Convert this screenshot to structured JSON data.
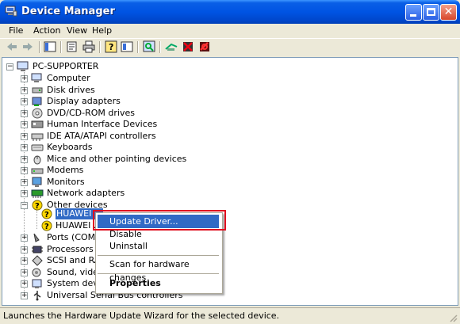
{
  "window": {
    "title": "Device Manager"
  },
  "menu": [
    "File",
    "Action",
    "View",
    "Help"
  ],
  "tree": {
    "root": "PC-SUPPORTER",
    "categories": [
      {
        "label": "Computer",
        "icon": "computer-icon"
      },
      {
        "label": "Disk drives",
        "icon": "disk-drive-icon"
      },
      {
        "label": "Display adapters",
        "icon": "display-adapter-icon"
      },
      {
        "label": "DVD/CD-ROM drives",
        "icon": "dvd-drive-icon"
      },
      {
        "label": "Human Interface Devices",
        "icon": "hid-icon"
      },
      {
        "label": "IDE ATA/ATAPI controllers",
        "icon": "ide-controller-icon"
      },
      {
        "label": "Keyboards",
        "icon": "keyboard-icon"
      },
      {
        "label": "Mice and other pointing devices",
        "icon": "mouse-icon"
      },
      {
        "label": "Modems",
        "icon": "modem-icon"
      },
      {
        "label": "Monitors",
        "icon": "monitor-icon"
      },
      {
        "label": "Network adapters",
        "icon": "network-adapter-icon"
      },
      {
        "label": "Other devices",
        "icon": "other-devices-icon"
      }
    ],
    "other_devices_children": [
      {
        "label": "HUAWEI ...",
        "selected": true
      },
      {
        "label": "HUAWEI ..."
      }
    ],
    "categories_after": [
      {
        "label": "Ports (COM &",
        "icon": "port-icon"
      },
      {
        "label": "Processors",
        "icon": "processor-icon"
      },
      {
        "label": "SCSI and RAID",
        "icon": "scsi-icon"
      },
      {
        "label": "Sound, video a",
        "icon": "sound-icon"
      },
      {
        "label": "System device",
        "icon": "system-device-icon"
      },
      {
        "label": "Universal Serial Bus controllers",
        "icon": "usb-icon"
      }
    ]
  },
  "context_menu": {
    "update_driver": "Update Driver...",
    "disable": "Disable",
    "uninstall": "Uninstall",
    "scan": "Scan for hardware changes",
    "properties": "Properties"
  },
  "status": "Launches the Hardware Update Wizard for the selected device.",
  "colors": {
    "titlebar": "#0054e3",
    "highlight": "#316ac5",
    "annotation_box": "#e01020"
  }
}
